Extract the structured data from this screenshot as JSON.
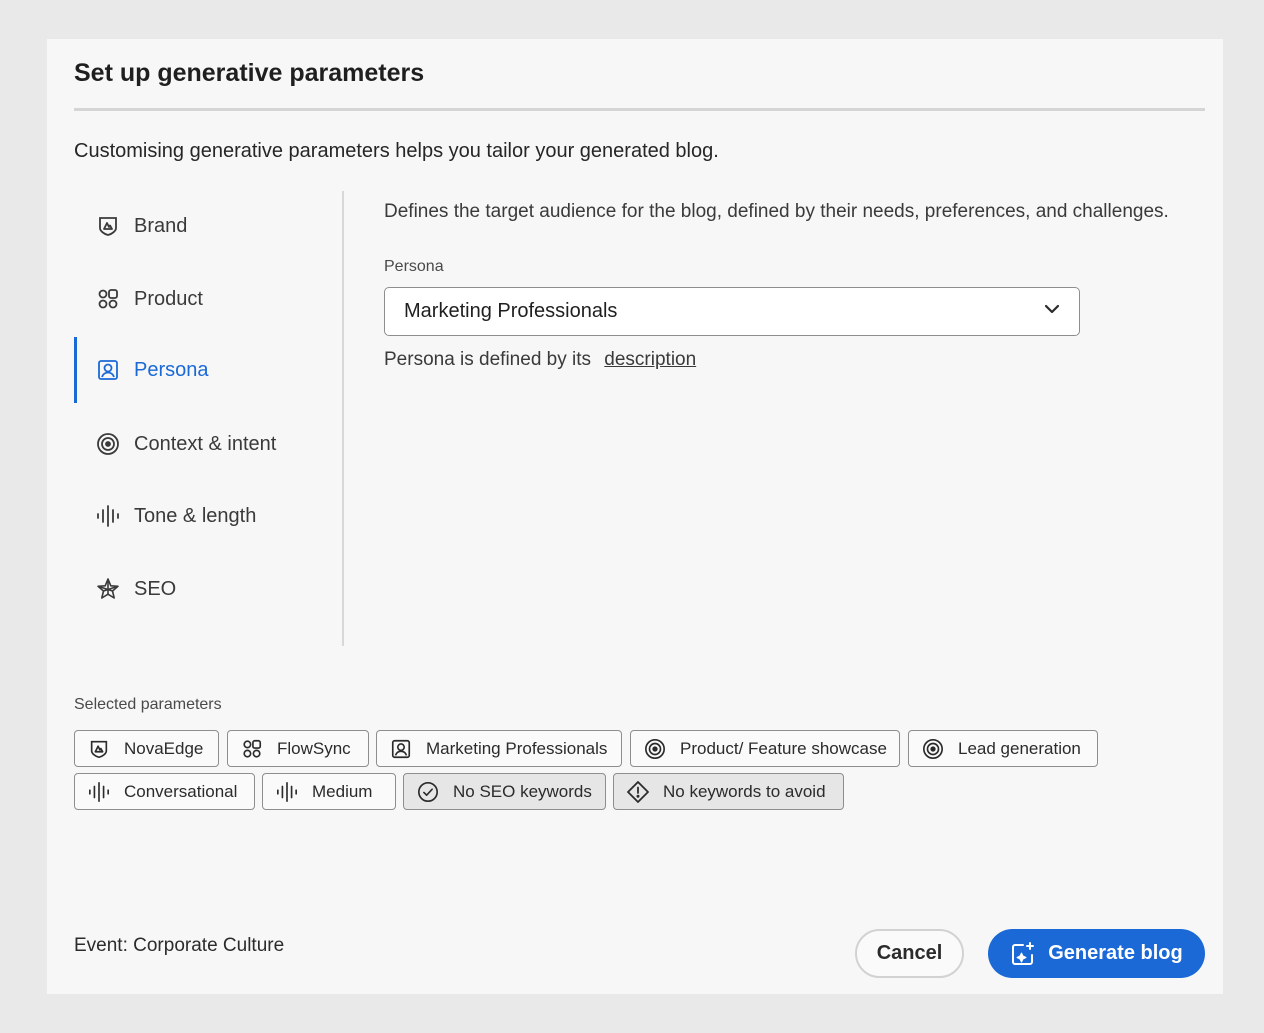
{
  "dialog": {
    "title": "Set up generative parameters",
    "subtitle": "Customising generative parameters helps you tailor your generated blog."
  },
  "nav": {
    "items": [
      {
        "label": "Brand",
        "icon": "brand-icon"
      },
      {
        "label": "Product",
        "icon": "product-icon"
      },
      {
        "label": "Persona",
        "icon": "persona-icon",
        "active": true
      },
      {
        "label": "Context & intent",
        "icon": "target-icon"
      },
      {
        "label": "Tone & length",
        "icon": "waveform-icon"
      },
      {
        "label": "SEO",
        "icon": "seo-icon"
      }
    ]
  },
  "persona": {
    "description": "Defines the target audience for the blog, defined by their needs, preferences, and challenges.",
    "field_label": "Persona",
    "selected": "Marketing Professionals",
    "note": "Persona is defined by its",
    "note_link": "description"
  },
  "selected_parameters": {
    "label": "Selected parameters",
    "chips": [
      {
        "label": "NovaEdge",
        "icon": "brand-icon"
      },
      {
        "label": "FlowSync",
        "icon": "product-icon"
      },
      {
        "label": "Marketing Professionals",
        "icon": "persona-icon"
      },
      {
        "label": "Product/ Feature showcase",
        "icon": "target-icon"
      },
      {
        "label": "Lead generation",
        "icon": "target-icon"
      },
      {
        "label": "Conversational",
        "icon": "waveform-icon"
      },
      {
        "label": "Medium",
        "icon": "waveform-icon"
      },
      {
        "label": "No SEO keywords",
        "icon": "check-circle-icon"
      },
      {
        "label": "No keywords to avoid",
        "icon": "alert-diamond-icon"
      }
    ]
  },
  "footer": {
    "event": "Event: Corporate Culture",
    "cancel_label": "Cancel",
    "generate_label": "Generate blog"
  },
  "colors": {
    "accent": "#1a69d6",
    "background": "#f7f7f7"
  }
}
